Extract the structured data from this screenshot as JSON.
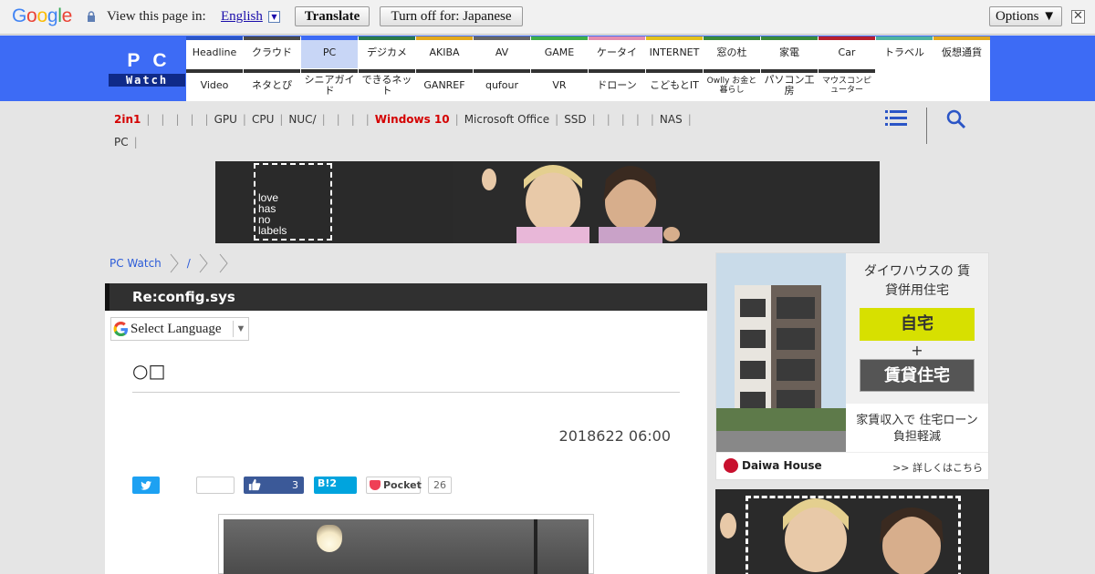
{
  "translate_bar": {
    "logo": "Google",
    "prompt": "View this page in:",
    "language": "English",
    "translate_button": "Translate",
    "turn_off_button": "Turn off for: Japanese",
    "options_button": "Options ▼",
    "close": "✕"
  },
  "site": {
    "logo_top": "PC",
    "logo_bottom": "Watch"
  },
  "nav": {
    "row1": [
      "Headline",
      "クラウド",
      "PC",
      "デジカメ",
      "AKIBA",
      "AV",
      "GAME",
      "ケータイ",
      "INTERNET",
      "窓の杜",
      "家電",
      "Car",
      "トラベル",
      "仮想通貨"
    ],
    "row2": [
      "Video",
      "ネタとぴ",
      "シニアガイド",
      "できるネット",
      "GANREF",
      "qufour",
      "VR",
      "ドローン",
      "こどもとIT",
      "Owlly お金と暮らし",
      "パソコン工房",
      "マウスコンピューター"
    ],
    "row1_colors": [
      "#2b55c6",
      "#4a4a4a",
      "#3d6bf5",
      "#2b7a4b",
      "#e3a91c",
      "#666666",
      "#3fae49",
      "#e48db0",
      "#e3c11c",
      "#3a8a3a",
      "#3a8a3a",
      "#b7202e",
      "#4fb3a0",
      "#e3a91c"
    ],
    "row2_colors": [
      "#333333",
      "#333333",
      "#333333",
      "#333333",
      "#333333",
      "#333333",
      "#333333",
      "#333333",
      "#333333",
      "#333333",
      "#333333",
      "#333333"
    ],
    "active": "PC"
  },
  "tags": {
    "items": [
      "2in1",
      "",
      "",
      "",
      "",
      "GPU",
      "CPU",
      "NUC/",
      "",
      "",
      "",
      "Windows 10",
      "Microsoft Office",
      "SSD",
      "",
      "",
      "",
      "",
      "NAS",
      "PC"
    ],
    "highlighted": [
      "2in1",
      "Windows 10"
    ]
  },
  "banner": {
    "text": "love has no labels"
  },
  "breadcrumb": {
    "home": "PC Watch",
    "sep_text": "/"
  },
  "article": {
    "section_title": "Re:config.sys",
    "select_language": "Select Language",
    "headline": "○□",
    "date": "2018622 06:00",
    "fb_count": "3",
    "hatena_count": "2",
    "pocket_label": "Pocket",
    "pocket_count": "26"
  },
  "ad": {
    "headline": "ダイワハウスの 賃貸併用住宅",
    "box1": "自宅",
    "plus": "+",
    "box2": "賃貸住宅",
    "sub": "家賃収入で 住宅ローン負担軽減",
    "brand": "Daiwa House",
    "more": ">> 詳しくはこちら"
  },
  "colors": {
    "header_blue": "#3d6bf5",
    "title_bar": "#303030",
    "link": "#2b5bd8",
    "highlight": "#d40000"
  }
}
